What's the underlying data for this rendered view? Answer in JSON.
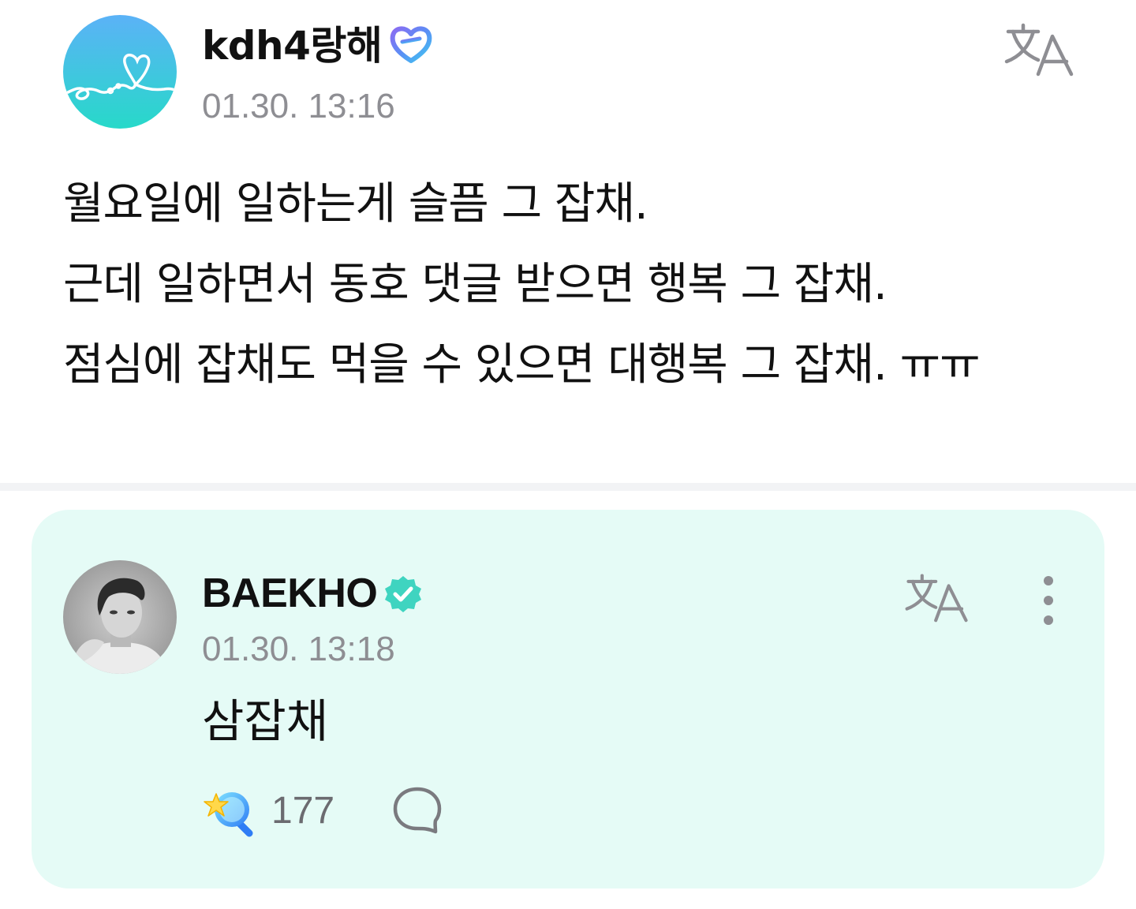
{
  "post": {
    "author": {
      "name": "kdh4랑해",
      "avatar_icon": "heart-doodle-avatar-icon",
      "badge_icon": "fan-membership-badge-icon"
    },
    "timestamp": "01.30. 13:16",
    "translate_icon": "translate-icon",
    "lines": [
      "월요일에 일하는게 슬픔 그 잡채.",
      "근데 일하면서 동호 댓글 받으면 행복 그 잡채.",
      "점심에 잡채도 먹을 수 있으면 대행복 그 잡채. ㅠㅠ"
    ]
  },
  "comment": {
    "author": {
      "name": "BAEKHO",
      "avatar_icon": "artist-photo-avatar",
      "badge_icon": "verified-badge-icon"
    },
    "timestamp": "01.30. 13:18",
    "text": "삼잡채",
    "like_count": "177",
    "icons": {
      "translate": "translate-icon",
      "more": "more-vertical-icon",
      "like": "star-lightstick-like-icon",
      "reply": "speech-bubble-reply-icon"
    }
  },
  "colors": {
    "card_background": "#e5fbf6",
    "timestamp_gray": "#8e8e93",
    "verified_teal": "#3fd4c0",
    "divider": "#f2f3f5"
  }
}
